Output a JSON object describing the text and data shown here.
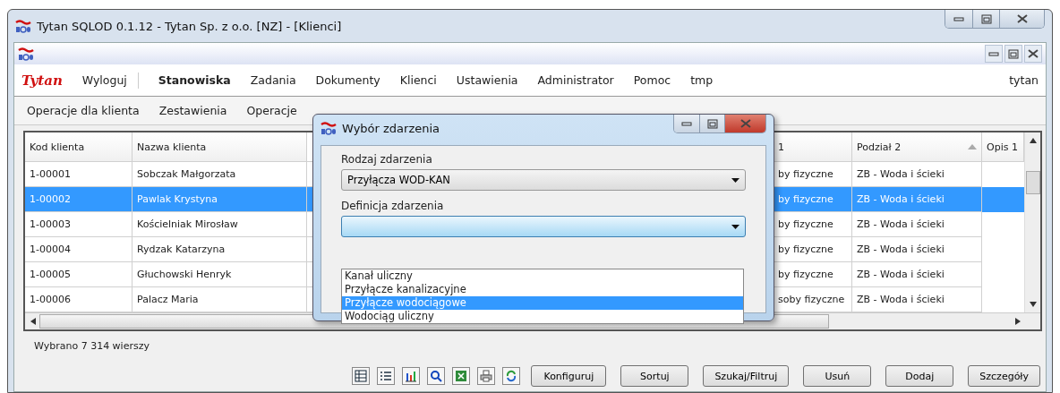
{
  "window": {
    "title": "Tytan SQLOD 0.1.12 - Tytan Sp. z o.o. [NZ] - [Klienci]"
  },
  "menu": {
    "brand": "Tytan",
    "logout": "Wyloguj",
    "items": [
      {
        "label": "Stanowiska",
        "selected": true
      },
      {
        "label": "Zadania",
        "selected": false
      },
      {
        "label": "Dokumenty",
        "selected": false
      },
      {
        "label": "Klienci",
        "selected": false
      },
      {
        "label": "Ustawienia",
        "selected": false
      },
      {
        "label": "Administrator",
        "selected": false
      },
      {
        "label": "Pomoc",
        "selected": false
      },
      {
        "label": "tmp",
        "selected": false
      }
    ],
    "user": "tytan"
  },
  "submenu": [
    "Operacje dla klienta",
    "Zestawienia",
    "Operacje"
  ],
  "table": {
    "columns": [
      {
        "label": "Kod klienta"
      },
      {
        "label": "Nazwa klienta"
      },
      {
        "label": "1"
      },
      {
        "label": "Podział 2",
        "sorted": true
      },
      {
        "label": "Opis 1"
      }
    ],
    "rows": [
      {
        "selected": false,
        "cells": [
          "1-00001",
          "Sobczak Małgorzata",
          "by fizyczne",
          "ZB - Woda i ścieki"
        ]
      },
      {
        "selected": true,
        "cells": [
          "1-00002",
          "Pawlak Krystyna",
          "by fizyczne",
          "ZB - Woda i ścieki"
        ]
      },
      {
        "selected": false,
        "cells": [
          "1-00003",
          "Kościelniak Mirosław",
          "by fizyczne",
          "ZB - Woda i ścieki"
        ]
      },
      {
        "selected": false,
        "cells": [
          "1-00004",
          "Rydzak Katarzyna",
          "by fizyczne",
          "ZB - Woda i ścieki"
        ]
      },
      {
        "selected": false,
        "cells": [
          "1-00005",
          "Głuchowski Henryk",
          "by fizyczne",
          "ZB - Woda i ścieki"
        ]
      },
      {
        "selected": false,
        "cells": [
          "1-00006",
          "Palacz Maria",
          "soby fizyczne",
          "ZB - Woda i ścieki"
        ]
      }
    ]
  },
  "status": "Wybrano 7 314 wierszy",
  "buttons": [
    "Konfiguruj",
    "Sortuj",
    "Szukaj/Filtruj",
    "Usuń",
    "Dodaj",
    "Szczegóły"
  ],
  "dialog": {
    "title": "Wybór zdarzenia",
    "fields": [
      {
        "label": "Rodzaj zdarzenia",
        "value": "Przyłącza WOD-KAN",
        "focused": false
      },
      {
        "label": "Definicja zdarzenia",
        "focused": true
      }
    ],
    "dropdown": [
      {
        "label": "Kanał uliczny",
        "selected": false
      },
      {
        "label": "Przyłącze kanalizacyjne",
        "selected": false
      },
      {
        "label": "Przyłącze wodociągowe",
        "selected": true
      },
      {
        "label": "Wodociąg uliczny",
        "selected": false
      }
    ]
  }
}
